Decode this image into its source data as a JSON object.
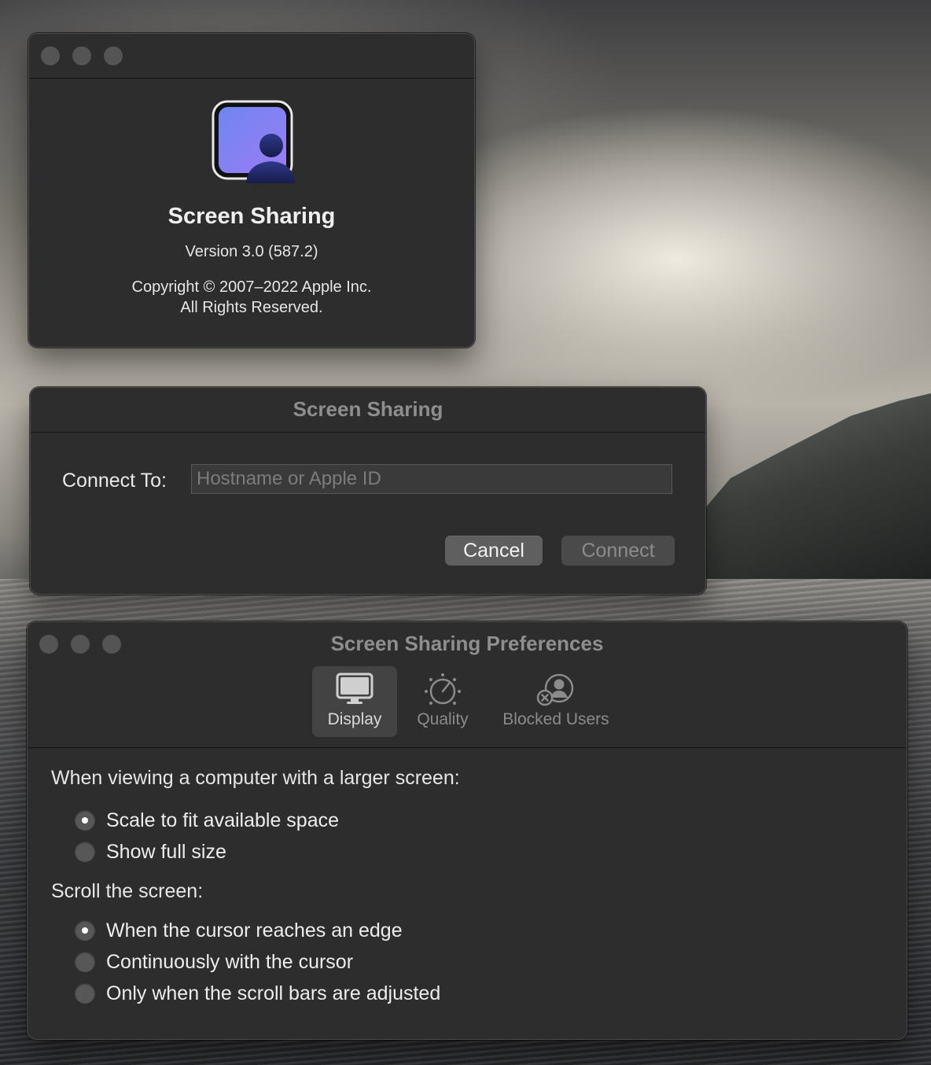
{
  "about": {
    "app_name": "Screen Sharing",
    "version": "Version 3.0 (587.2)",
    "copyright_line1": "Copyright © 2007–2022 Apple Inc.",
    "copyright_line2": "All Rights Reserved."
  },
  "connect": {
    "title": "Screen Sharing",
    "label": "Connect To:",
    "input_value": "",
    "input_placeholder": "Hostname or Apple ID",
    "cancel_label": "Cancel",
    "connect_label": "Connect"
  },
  "prefs": {
    "title": "Screen Sharing Preferences",
    "tabs": [
      {
        "label": "Display",
        "icon": "display-icon",
        "selected": true
      },
      {
        "label": "Quality",
        "icon": "quality-gauge-icon",
        "selected": false
      },
      {
        "label": "Blocked Users",
        "icon": "blocked-users-icon",
        "selected": false
      }
    ],
    "larger_screen_heading": "When viewing a computer with a larger screen:",
    "larger_screen_options": [
      {
        "label": "Scale to fit available space",
        "selected": true
      },
      {
        "label": "Show full size",
        "selected": false
      }
    ],
    "scroll_heading": "Scroll the screen:",
    "scroll_options": [
      {
        "label": "When the cursor reaches an edge",
        "selected": true
      },
      {
        "label": "Continuously with the cursor",
        "selected": false
      },
      {
        "label": "Only when the scroll bars are adjusted",
        "selected": false
      }
    ]
  },
  "colors": {
    "window_bg": "#2d2d2d",
    "selected_tab_bg": "#434343",
    "app_icon_gradient_top": "#6f86f2",
    "app_icon_gradient_bottom": "#9b7cf4"
  }
}
